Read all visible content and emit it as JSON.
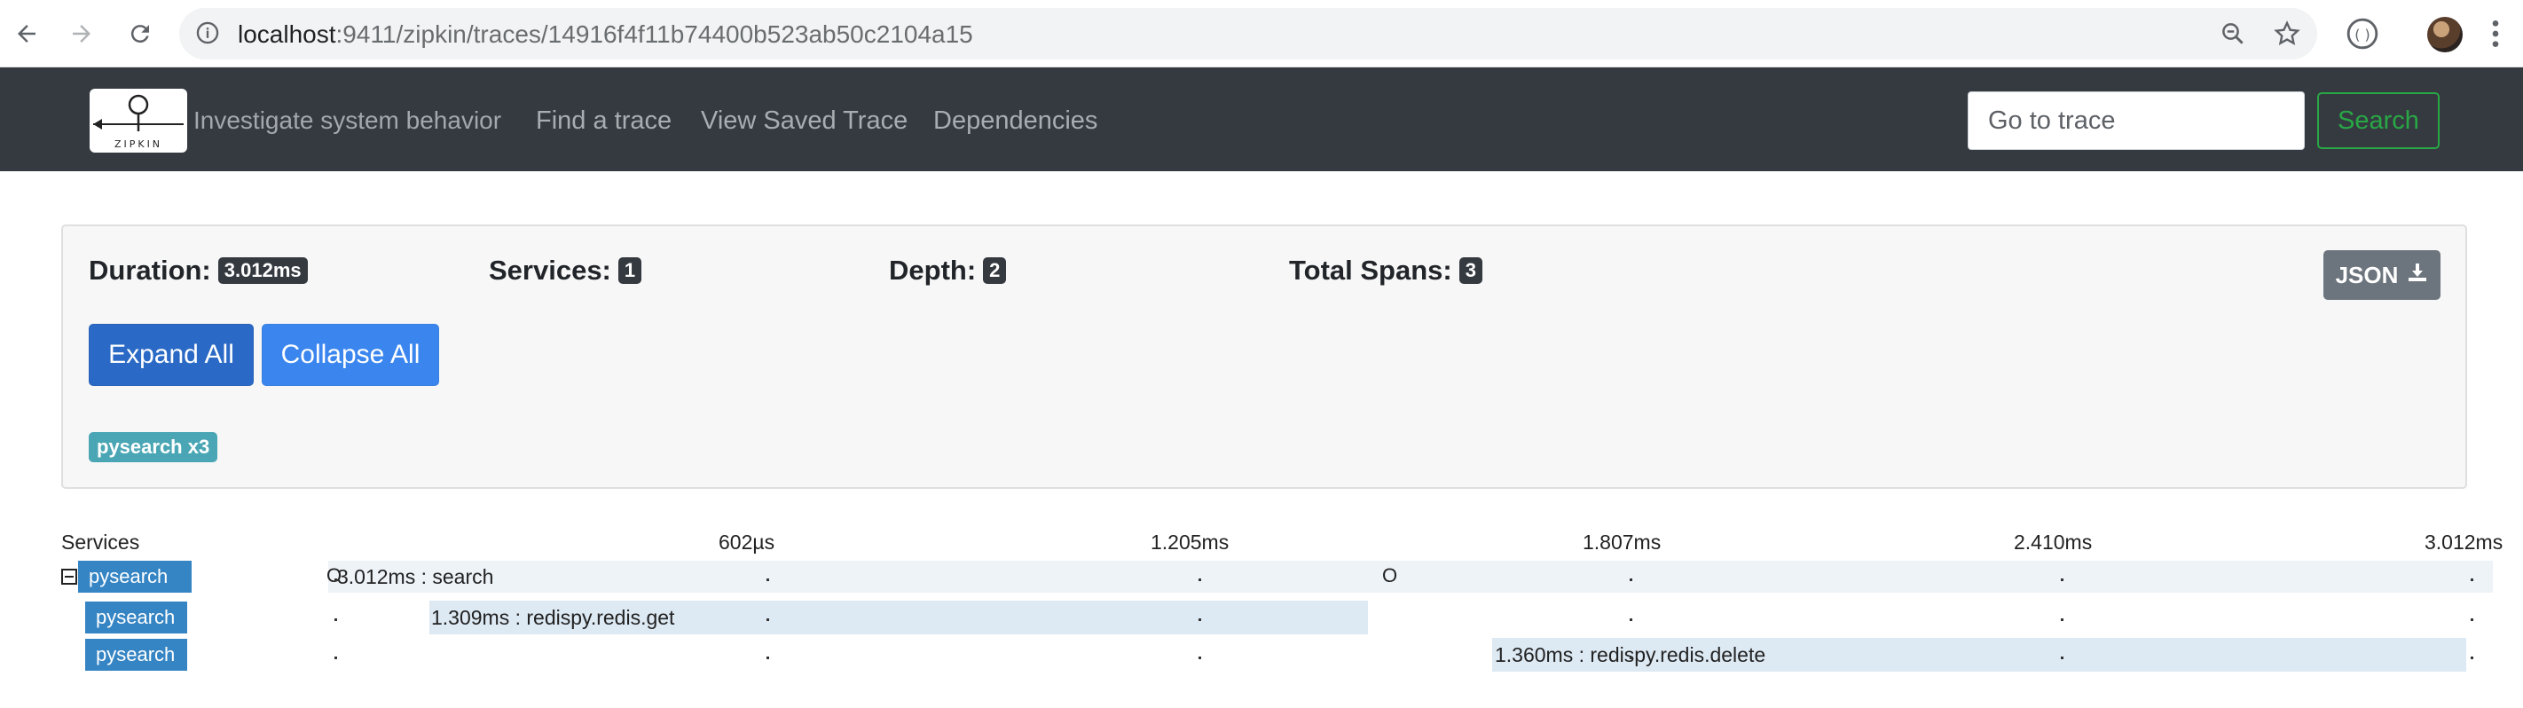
{
  "browser": {
    "url_host": "localhost",
    "url_rest": ":9411/zipkin/traces/14916f4f11b74400b523ab50c2104a15",
    "icons": [
      "back-icon",
      "forward-icon",
      "reload-icon",
      "info-icon",
      "zoom-icon",
      "star-icon",
      "extension-icon",
      "avatar",
      "menu-icon"
    ]
  },
  "navbar": {
    "tagline": "Investigate system behavior",
    "links": [
      "Find a trace",
      "View Saved Trace",
      "Dependencies"
    ],
    "goto_placeholder": "Go to trace",
    "search_label": "Search",
    "logo_text": "ZIPKIN"
  },
  "summary": {
    "duration_label": "Duration:",
    "duration_value": "3.012ms",
    "services_label": "Services:",
    "services_value": "1",
    "depth_label": "Depth:",
    "depth_value": "2",
    "spans_label": "Total Spans:",
    "spans_value": "3",
    "json_label": "JSON",
    "expand_label": "Expand All",
    "collapse_label": "Collapse All",
    "service_badge": "pysearch x3"
  },
  "timeline": {
    "services_header": "Services",
    "ticks": [
      "602µs",
      "1.205ms",
      "1.807ms",
      "2.410ms",
      "3.012ms"
    ],
    "rows": [
      {
        "service": "pysearch",
        "span": "3.012ms : search",
        "start_ms": 0,
        "duration_ms": 3.012
      },
      {
        "service": "pysearch",
        "span": "1.309ms : redispy.redis.get",
        "start_ms": 0.121,
        "duration_ms": 1.309
      },
      {
        "service": "pysearch",
        "span": "1.360ms : redispy.redis.delete",
        "start_ms": 1.622,
        "duration_ms": 1.36
      }
    ],
    "marker_o": "O"
  },
  "colors": {
    "navbar_bg": "#353a40",
    "search_green": "#28a745",
    "service_blue": "#3584c3",
    "bar_bg": "#dde9f3",
    "badge_teal": "#4aa6b5"
  }
}
